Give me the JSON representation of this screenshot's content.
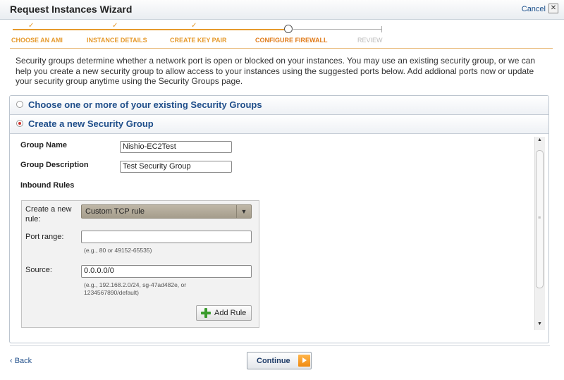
{
  "window": {
    "title": "Request Instances Wizard",
    "cancel_label": "Cancel",
    "close_glyph": "✕"
  },
  "progress": {
    "steps": [
      {
        "label": "CHOOSE AN AMI",
        "state": "done"
      },
      {
        "label": "INSTANCE DETAILS",
        "state": "done"
      },
      {
        "label": "CREATE KEY PAIR",
        "state": "done"
      },
      {
        "label": "CONFIGURE FIREWALL",
        "state": "current"
      },
      {
        "label": "REVIEW",
        "state": "pending"
      }
    ],
    "check_glyph": "✓",
    "accent_color": "#e69a2d"
  },
  "intro": "Security groups determine whether a network port is open or blocked on your instances. You may use an existing security group, or we can help you create a new security group to allow access to your instances using the suggested ports below. Add addional ports now or update your security group anytime using the Security Groups page.",
  "options": {
    "existing_label": "Choose one or more of your existing Security Groups",
    "new_label": "Create a new Security Group",
    "selected": "new"
  },
  "form": {
    "group_name_label": "Group Name",
    "group_name_value": "Nishio-EC2Test",
    "group_desc_label": "Group Description",
    "group_desc_value": "Test Security Group",
    "inbound_label": "Inbound Rules"
  },
  "rule": {
    "create_label_line1": "Create a new",
    "create_label_line2": "rule:",
    "rule_type": "Custom TCP rule",
    "dropdown_glyph": "▼",
    "port_label": "Port range:",
    "port_value": "",
    "port_hint": "(e.g., 80 or 49152-65535)",
    "source_label": "Source:",
    "source_value": "0.0.0.0/0",
    "source_hint_line1": "(e.g., 192.168.2.0/24, sg-47ad482e, or",
    "source_hint_line2": "1234567890/default)",
    "add_rule_label": "Add Rule"
  },
  "scrollbar": {
    "up_glyph": "▲",
    "down_glyph": "▼",
    "grip_glyph": "≡"
  },
  "footer": {
    "back_label": "‹ Back",
    "continue_label": "Continue"
  }
}
